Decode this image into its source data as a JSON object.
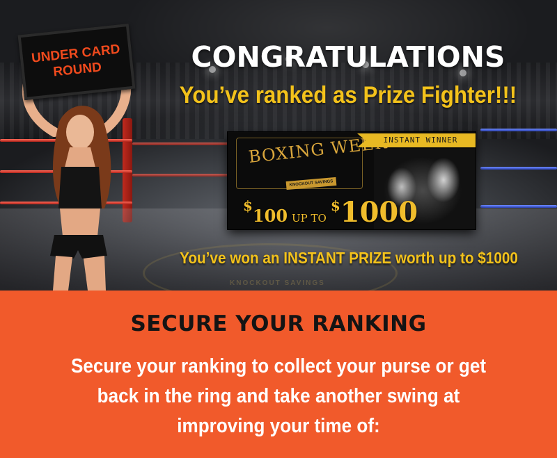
{
  "hero": {
    "sign_text": "UNDER CARD\nROUND",
    "headline": "CONGRATULATIONS",
    "subheadline": "You’ve ranked as Prize Fighter!!!",
    "instant_prize_text": "You’ve won an INSTANT PRIZE worth up to $1000"
  },
  "ticket": {
    "ribbon": "INSTANT WINNER",
    "title": "BOXING WEEK",
    "subtitle": "KNOCKOUT SAVINGS",
    "prize_low": "100",
    "up_to": "UP TO",
    "prize_high": "1000",
    "currency": "$"
  },
  "floor_logo_text": "KNOCKOUT SAVINGS",
  "secure": {
    "title": "SECURE YOUR RANKING",
    "body_lines": [
      "Secure your ranking to collect your purse or get",
      "back in the ring and take another swing at",
      "improving your time of:"
    ]
  },
  "colors": {
    "accent_orange": "#f15a2b",
    "gold": "#f3c21b",
    "sign_text": "#f04a1d"
  }
}
